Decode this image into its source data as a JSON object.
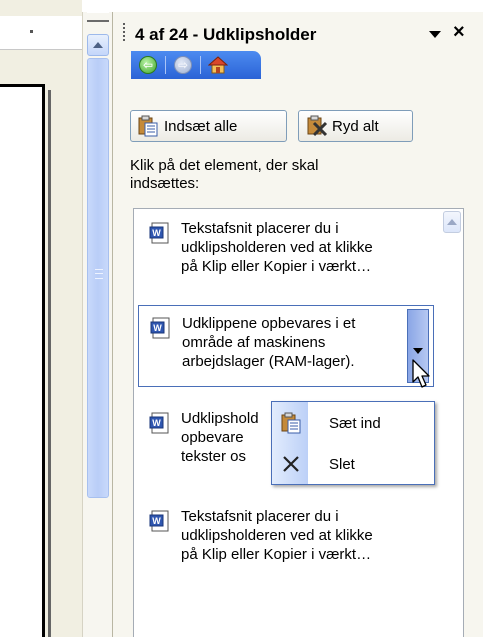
{
  "pane": {
    "title": "4 af 24 - Udklipsholder",
    "close": "×",
    "paste_all_label": "Indsæt alle",
    "clear_all_label": "Ryd alt",
    "instruction": "Klik på det element, der skal indsættes:"
  },
  "nav": {
    "back_glyph": "⇦",
    "forward_glyph": "⇨"
  },
  "clips": [
    {
      "text": "Tekstafsnit placerer du i\nudklipsholderen ved at klikke\npå Klip eller Kopier i værkt…"
    },
    {
      "text": "Udklippene opbevares i et\nområde af maskinens\narbejdslager (RAM-lager)."
    },
    {
      "text": "Udklipshold\nopbevare\ntekster os"
    },
    {
      "text": "Tekstafsnit placerer du i\nudklipsholderen ved at klikke\npå Klip eller Kopier i værkt…"
    }
  ],
  "context_menu": {
    "paste_label": "Sæt ind",
    "delete_label": "Slet"
  },
  "colors": {
    "nav_bar": "#2b63d6",
    "selection_border": "#4a6fb8"
  }
}
